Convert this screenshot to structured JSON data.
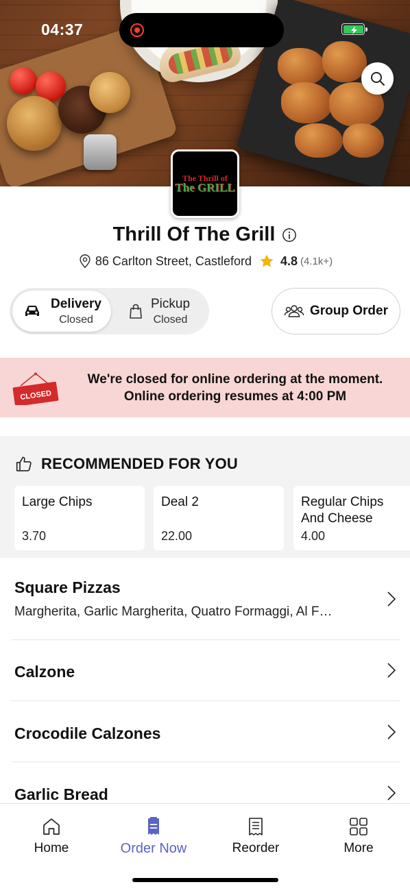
{
  "status_bar": {
    "time": "04:37"
  },
  "restaurant": {
    "name": "Thrill Of The Grill",
    "address": "86 Carlton Street, Castleford",
    "rating": "4.8",
    "rating_count": "(4.1k+)",
    "logo_text_line1": "The Thrill of",
    "logo_text_line2": "The GRILL"
  },
  "order_mode": {
    "delivery": {
      "label": "Delivery",
      "status": "Closed",
      "selected": true
    },
    "pickup": {
      "label": "Pickup",
      "status": "Closed",
      "selected": false
    },
    "group_order_label": "Group Order"
  },
  "banner": {
    "sign_text": "CLOSED",
    "line1": "We're closed for online ordering at the moment.",
    "line2": "Online ordering resumes at 4:00 PM"
  },
  "recommended": {
    "title": "RECOMMENDED FOR YOU",
    "items": [
      {
        "name": "Large Chips",
        "price": "3.70"
      },
      {
        "name": "Deal 2",
        "price": "22.00"
      },
      {
        "name": "Regular Chips And Cheese",
        "price": "4.00"
      }
    ]
  },
  "categories": [
    {
      "name": "Square Pizzas",
      "description": "Margherita, Garlic Margherita, Quatro Formaggi, Al F…"
    },
    {
      "name": "Calzone",
      "description": ""
    },
    {
      "name": "Crocodile Calzones",
      "description": ""
    },
    {
      "name": "Garlic Bread",
      "description": ""
    }
  ],
  "tab_bar": {
    "items": [
      {
        "label": "Home",
        "icon": "home-icon",
        "active": false
      },
      {
        "label": "Order Now",
        "icon": "order-icon",
        "active": true
      },
      {
        "label": "Reorder",
        "icon": "receipt-icon",
        "active": false
      },
      {
        "label": "More",
        "icon": "grid-icon",
        "active": false
      }
    ]
  },
  "colors": {
    "accent": "#5b63c4",
    "banner_bg": "#f9d6d6",
    "closed_red": "#d42a2a",
    "star": "#f5b400"
  }
}
